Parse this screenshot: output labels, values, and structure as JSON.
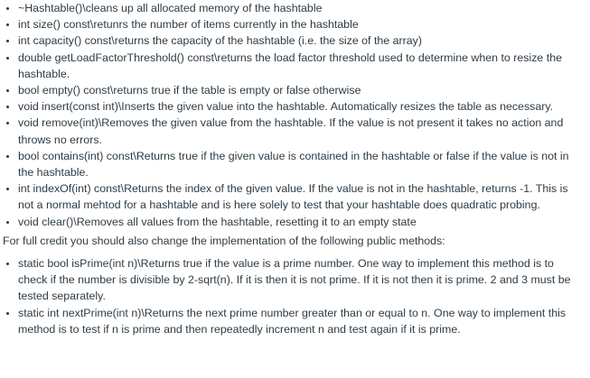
{
  "methods_list": [
    "~Hashtable()\\cleans up all allocated memory of the hashtable",
    "int size() const\\retunrs the number of items currently in the hashtable",
    "int capacity() const\\returns the capacity of the hashtable (i.e. the size of the array)",
    "double getLoadFactorThreshold() const\\returns the load factor threshold used to determine when to resize the hashtable.",
    "bool empty() const\\returns true if the table is empty or false otherwise",
    "void insert(const int)\\Inserts the given value into the hashtable. Automatically resizes the table as necessary.",
    "void remove(int)\\Removes the given value from the hashtable. If the value is not present it takes no action and throws no errors.",
    "bool contains(int) const\\Returns true if the given value is contained in the hashtable or false if the value is not in the hashtable.",
    "int indexOf(int) const\\Returns the index of the given value. If the value is not in the hashtable, returns -1. This is not a normal mehtod for a hashtable and is here solely to test that your hashtable does quadratic probing.",
    "void clear()\\Removes all values from the hashtable, resetting it to an empty state"
  ],
  "intro_paragraph": "For full credit you should also change the implementation of the following public methods:",
  "public_methods_list": [
    "static bool isPrime(int n)\\Returns true if the value is a prime number. One way to implement this method is to check if the number is divisible by 2-sqrt(n). If it is then it is not prime. If it is not then it is prime. 2 and 3 must be tested separately.",
    "static int nextPrime(int n)\\Returns the next prime number greater than or equal to n. One way to implement this method is to test if n is prime and then repeatedly increment n and test again if it is prime."
  ]
}
